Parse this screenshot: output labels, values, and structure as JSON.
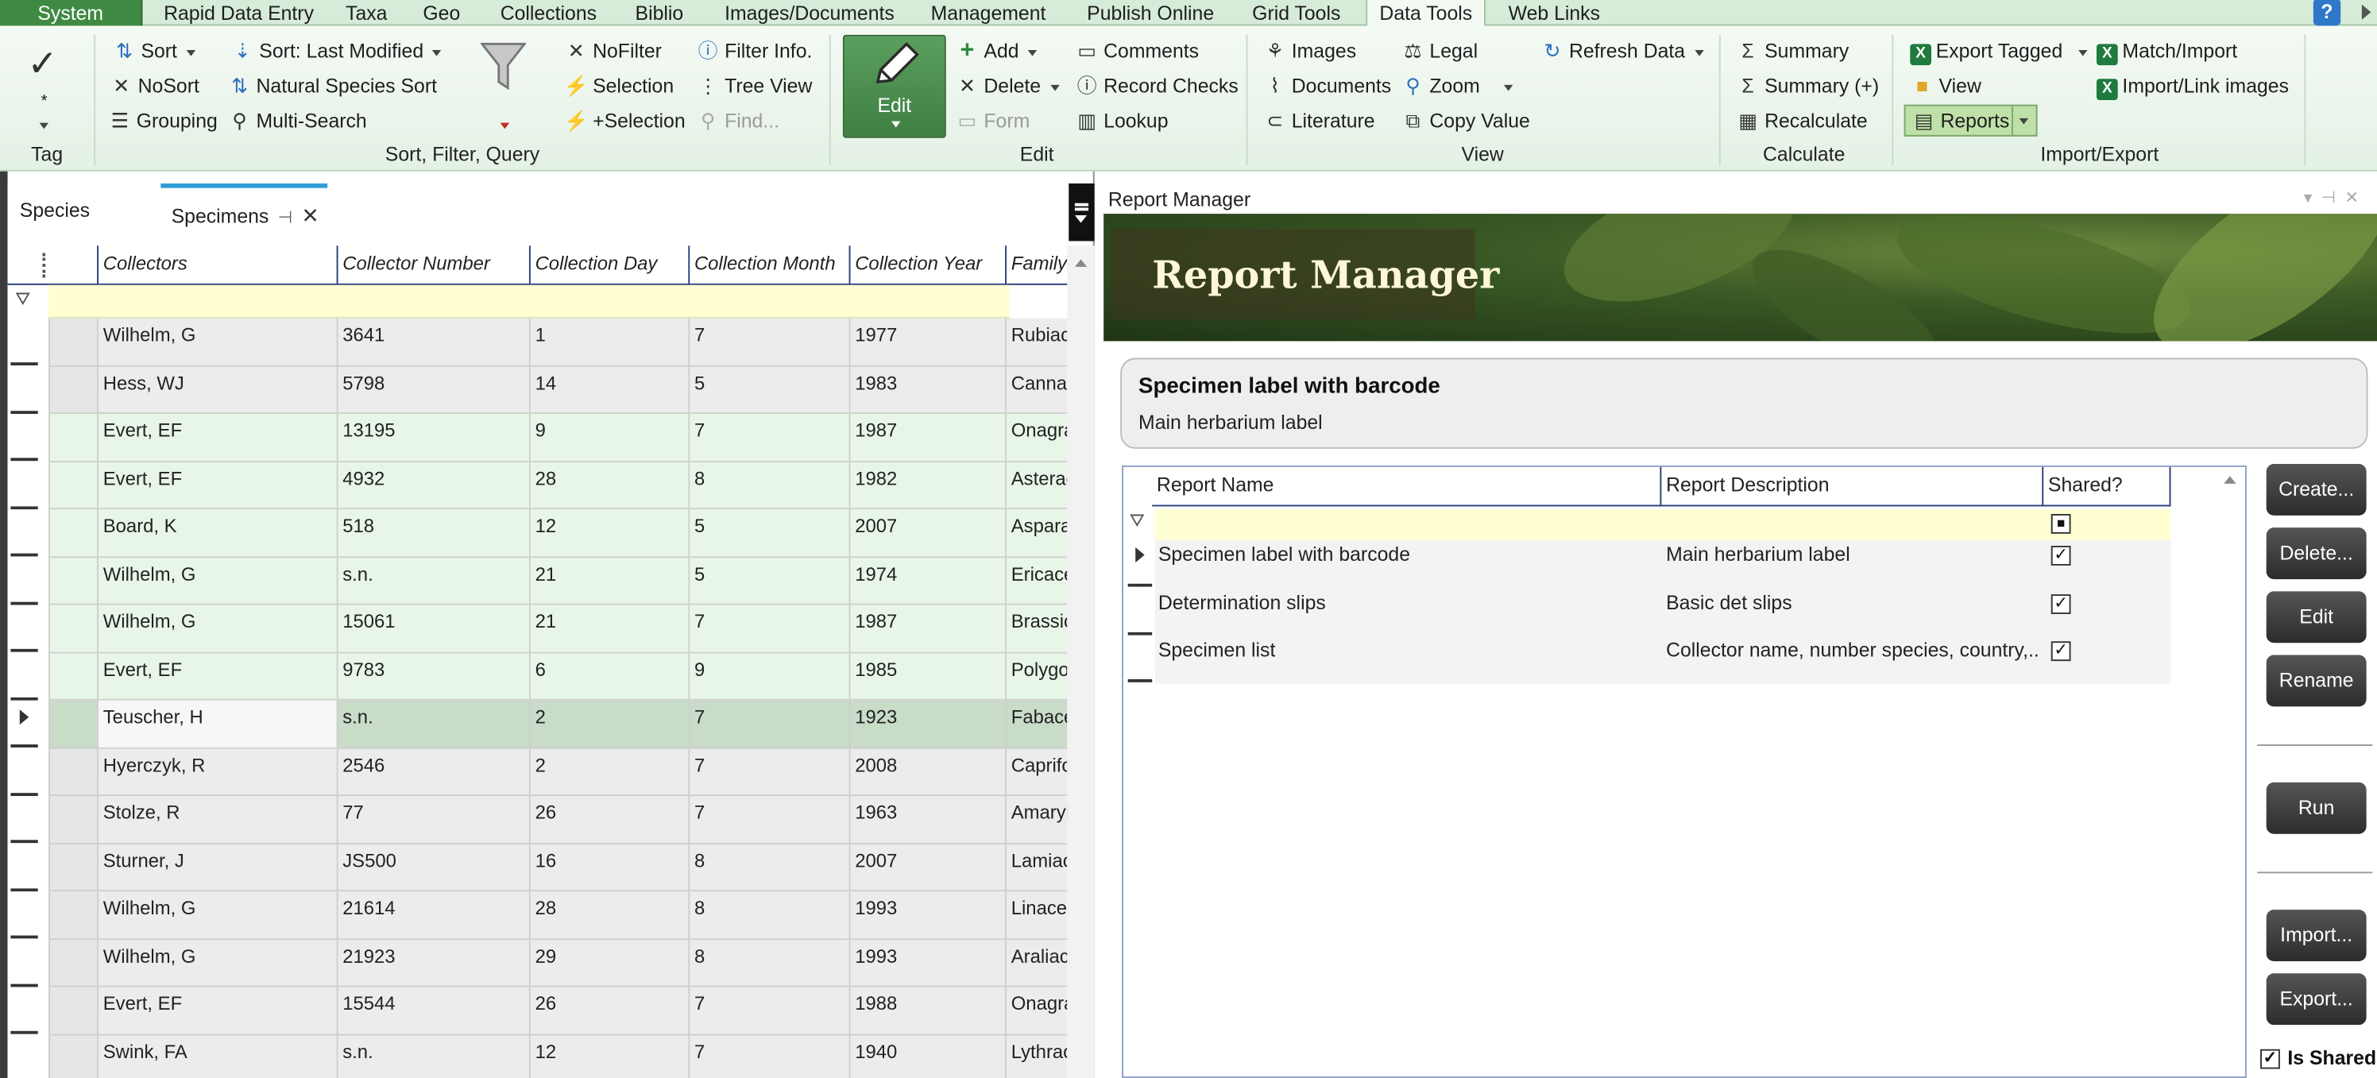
{
  "menu": {
    "system": "System",
    "tabs": [
      "Rapid Data Entry",
      "Taxa",
      "Geo",
      "Collections",
      "Biblio",
      "Images/Documents",
      "Management",
      "Publish Online",
      "Grid Tools",
      "Data Tools",
      "Web Links"
    ],
    "active_tab": "Data Tools",
    "help": "?"
  },
  "ribbon": {
    "tag": {
      "star": "*",
      "label": "Tag"
    },
    "sort_filter": {
      "sort": "Sort",
      "sort_last_modified": "Sort: Last Modified",
      "nosort": "NoSort",
      "natural_species_sort": "Natural Species Sort",
      "grouping": "Grouping",
      "multi_search": "Multi-Search",
      "nofilter": "NoFilter",
      "selection": "Selection",
      "plus_selection": "+Selection",
      "filter_info": "Filter Info.",
      "tree_view": "Tree View",
      "find": "Find...",
      "label": "Sort, Filter, Query"
    },
    "edit": {
      "edit": "Edit",
      "add": "Add",
      "delete": "Delete",
      "form": "Form",
      "comments": "Comments",
      "record_checks": "Record Checks",
      "lookup": "Lookup",
      "label": "Edit"
    },
    "view": {
      "images": "Images",
      "documents": "Documents",
      "literature": "Literature",
      "legal": "Legal",
      "zoom": "Zoom",
      "copy_value": "Copy Value",
      "refresh_data": "Refresh Data",
      "label": "View"
    },
    "calculate": {
      "summary": "Summary",
      "summary_plus": "Summary (+)",
      "recalculate": "Recalculate",
      "label": "Calculate"
    },
    "import_export": {
      "export_tagged": "Export Tagged",
      "view": "View",
      "reports": "Reports",
      "match_import": "Match/Import",
      "import_link_images": "Import/Link images",
      "label": "Import/Export"
    }
  },
  "left_pane": {
    "tabs": [
      "Species",
      "Specimens"
    ],
    "active_tab": "Specimens",
    "columns": [
      "Collectors",
      "Collector Number",
      "Collection Day",
      "Collection Month",
      "Collection Year",
      "Family"
    ],
    "rows": [
      [
        "Wilhelm, G",
        "3641",
        "1",
        "7",
        "1977",
        "Rubiaceae"
      ],
      [
        "Hess, WJ",
        "5798",
        "14",
        "5",
        "1983",
        "Cannabaceae"
      ],
      [
        "Evert, EF",
        "13195",
        "9",
        "7",
        "1987",
        "Onagraceae"
      ],
      [
        "Evert, EF",
        "4932",
        "28",
        "8",
        "1982",
        "Asteraceae"
      ],
      [
        "Board, K",
        "518",
        "12",
        "5",
        "2007",
        "Asparagaceae"
      ],
      [
        "Wilhelm, G",
        "s.n.",
        "21",
        "5",
        "1974",
        "Ericaceae"
      ],
      [
        "Wilhelm, G",
        "15061",
        "21",
        "7",
        "1987",
        "Brassicaceae"
      ],
      [
        "Evert, EF",
        "9783",
        "6",
        "9",
        "1985",
        "Polygonaceae"
      ],
      [
        "Teuscher, H",
        "s.n.",
        "2",
        "7",
        "1923",
        "Fabaceae"
      ],
      [
        "Hyerczyk, R",
        "2546",
        "2",
        "7",
        "2008",
        "Caprifoliaceae"
      ],
      [
        "Stolze, R",
        "77",
        "26",
        "7",
        "1963",
        "Amaryllidaceae"
      ],
      [
        "Sturner, J",
        "JS500",
        "16",
        "8",
        "2007",
        "Lamiaceae"
      ],
      [
        "Wilhelm, G",
        "21614",
        "28",
        "8",
        "1993",
        "Linaceae"
      ],
      [
        "Wilhelm, G",
        "21923",
        "29",
        "8",
        "1993",
        "Araliaceae"
      ],
      [
        "Evert, EF",
        "15544",
        "26",
        "7",
        "1988",
        "Onagraceae"
      ],
      [
        "Swink, FA",
        "s.n.",
        "12",
        "7",
        "1940",
        "Lythraceae"
      ]
    ],
    "current_row": 8
  },
  "report_manager": {
    "window_title": "Report Manager",
    "banner_title": "Report Manager",
    "selected_name": "Specimen label with barcode",
    "selected_description": "Main herbarium label",
    "columns": [
      "Report Name",
      "Report Description",
      "Shared?"
    ],
    "reports": [
      {
        "name": "Specimen label with barcode",
        "description": "Main herbarium label",
        "shared": "✓"
      },
      {
        "name": "Determination slips",
        "description": "Basic det slips",
        "shared": "✓"
      },
      {
        "name": "Specimen list",
        "description": "Collector name, number species, country,...",
        "shared": "✓"
      }
    ],
    "buttons": {
      "create": "Create...",
      "delete": "Delete...",
      "edit": "Edit",
      "rename": "Rename",
      "run": "Run",
      "import": "Import...",
      "export": "Export..."
    },
    "is_shared_label": "Is Shared",
    "is_shared_check": "✓"
  }
}
